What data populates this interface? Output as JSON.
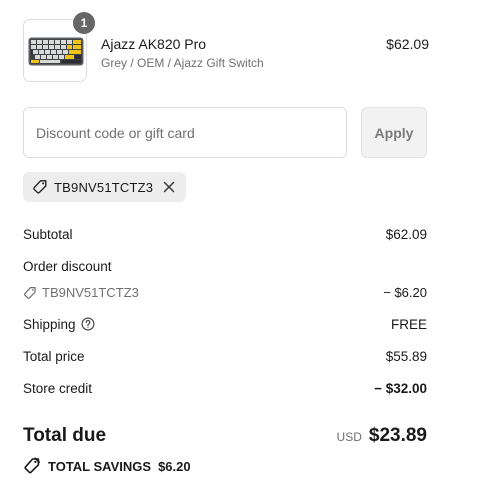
{
  "product": {
    "quantity": "1",
    "name": "Ajazz AK820 Pro",
    "variant": "Grey / OEM / Ajazz Gift Switch",
    "price": "$62.09"
  },
  "discount": {
    "placeholder": "Discount code or gift card",
    "apply_label": "Apply",
    "applied_code": "TB9NV51TCTZ3"
  },
  "summary": {
    "subtotal_label": "Subtotal",
    "subtotal_value": "$62.09",
    "order_discount_label": "Order discount",
    "order_discount_code": "TB9NV51TCTZ3",
    "order_discount_value": "− $6.20",
    "shipping_label": "Shipping",
    "shipping_value": "FREE",
    "total_price_label": "Total price",
    "total_price_value": "$55.89",
    "store_credit_label": "Store credit",
    "store_credit_value": "− $32.00"
  },
  "total": {
    "label": "Total due",
    "currency": "USD",
    "value": "$23.89"
  },
  "savings": {
    "label": "TOTAL SAVINGS",
    "amount": "$6.20"
  },
  "colors": {
    "text": "#1a1a1a",
    "muted": "#707070",
    "border": "#dedede",
    "chip_bg": "#ededed",
    "badge_bg": "#666666"
  },
  "icons": [
    "keyboard-product-image",
    "tag-icon",
    "close-icon",
    "help-circle-icon",
    "savings-tag-icon"
  ]
}
